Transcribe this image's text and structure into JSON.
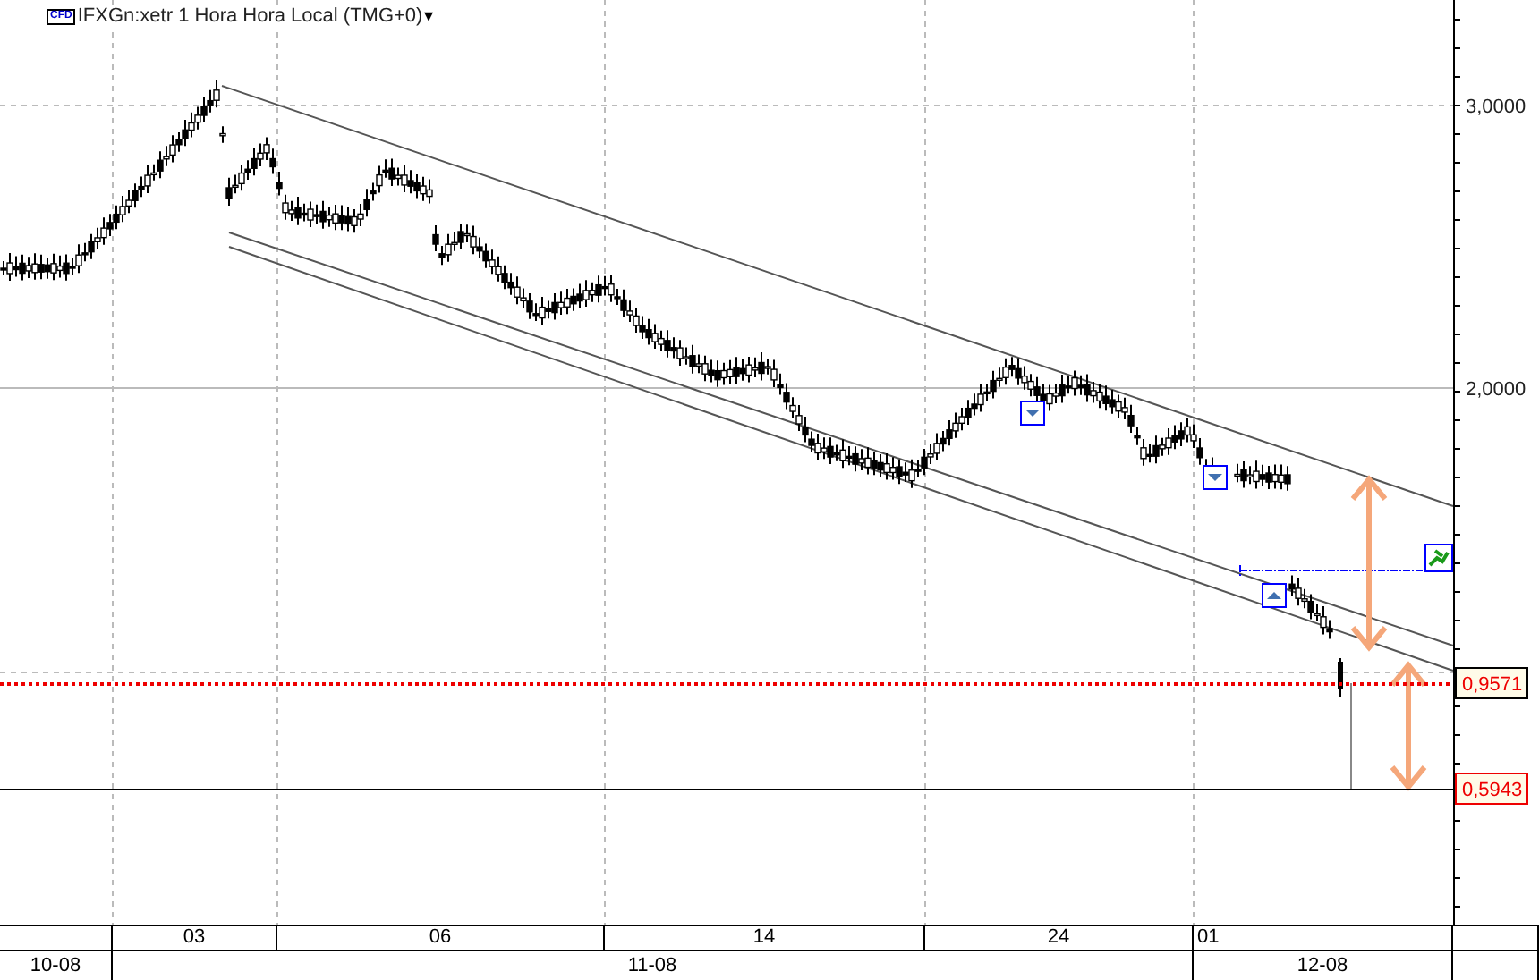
{
  "header": {
    "badge": "CFD",
    "title": "IFXGn:xetr 1 Hora Hora Local (TMG+0)",
    "caret": "▾"
  },
  "price_axis": {
    "labels": [
      "3,0000",
      "2,0000"
    ],
    "markers": [
      {
        "value": "0,9571",
        "kind": "last"
      },
      {
        "value": "0,5943",
        "kind": "target"
      }
    ]
  },
  "time_axis": {
    "days": [
      "03",
      "06",
      "14",
      "24",
      "01"
    ],
    "months": [
      "10-08",
      "11-08",
      "12-08"
    ]
  }
}
